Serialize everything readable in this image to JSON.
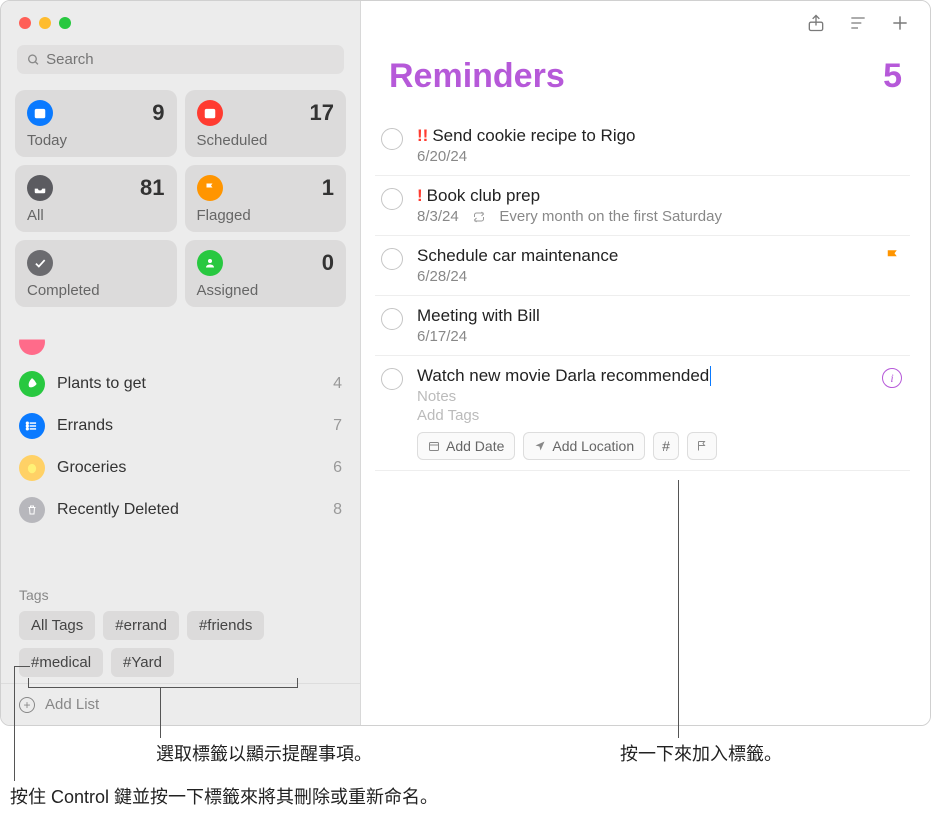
{
  "search": {
    "placeholder": "Search"
  },
  "smart_lists": [
    {
      "label": "Today",
      "count": 9,
      "color": "#0a7aff",
      "icon": "calendar"
    },
    {
      "label": "Scheduled",
      "count": 17,
      "color": "#ff3b30",
      "icon": "calendar"
    },
    {
      "label": "All",
      "count": 81,
      "color": "#5b5b60",
      "icon": "tray"
    },
    {
      "label": "Flagged",
      "count": 1,
      "color": "#ff9500",
      "icon": "flag"
    },
    {
      "label": "Completed",
      "count": "",
      "color": "#6b6b6f",
      "icon": "check"
    },
    {
      "label": "Assigned",
      "count": 0,
      "color": "#28c840",
      "icon": "person"
    }
  ],
  "lists": [
    {
      "name": "",
      "count": "",
      "color": "#ff6b8a",
      "partial": true
    },
    {
      "name": "Plants to get",
      "count": 4,
      "color": "#28c840",
      "icon": "leaf"
    },
    {
      "name": "Errands",
      "count": 7,
      "color": "#0a7aff",
      "icon": "list"
    },
    {
      "name": "Groceries",
      "count": 6,
      "color": "#ffd166",
      "icon": "lemon"
    },
    {
      "name": "Recently Deleted",
      "count": 8,
      "color": "#b7b7bc",
      "icon": "trash"
    }
  ],
  "tags": {
    "title": "Tags",
    "items": [
      "All Tags",
      "#errand",
      "#friends",
      "#medical",
      "#Yard"
    ]
  },
  "add_list_label": "Add List",
  "header": {
    "title": "Reminders",
    "count": 5
  },
  "reminders": [
    {
      "priority": "!!",
      "title": "Send cookie recipe to Rigo",
      "meta": "6/20/24"
    },
    {
      "priority": "!",
      "title": "Book club prep",
      "meta": "8/3/24",
      "repeat": "Every month on the first Saturday"
    },
    {
      "priority": "",
      "title": "Schedule car maintenance",
      "meta": "6/28/24",
      "flagged": true
    },
    {
      "priority": "",
      "title": "Meeting with Bill",
      "meta": "6/17/24"
    },
    {
      "priority": "",
      "title": "Watch new movie Darla recommended",
      "editing": true,
      "notes": "Notes",
      "addtags": "Add Tags",
      "actions": {
        "date": "Add Date",
        "location": "Add Location"
      }
    }
  ],
  "callouts": {
    "select_tag": "選取標籤以顯示提醒事項。",
    "add_tag_click": "按一下來加入標籤。",
    "control_click": "按住 Control 鍵並按一下標籤來將其刪除或重新命名。"
  }
}
